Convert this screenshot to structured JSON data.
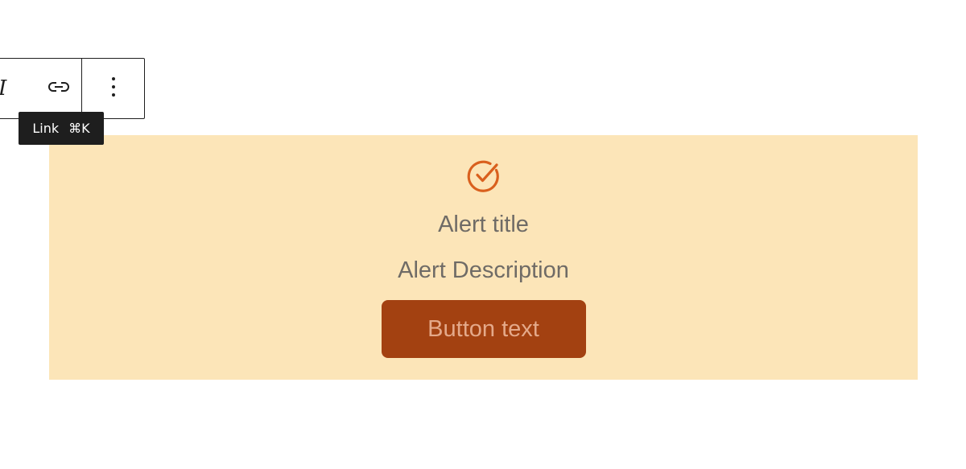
{
  "toolbar": {
    "italic_glyph": "I",
    "items": [
      {
        "name": "italic",
        "icon": "italic-icon"
      },
      {
        "name": "link",
        "icon": "link-icon"
      },
      {
        "name": "more-options",
        "icon": "more-vertical-icon"
      }
    ]
  },
  "tooltip": {
    "label": "Link",
    "shortcut": "⌘K"
  },
  "alert": {
    "icon": "check-circle-icon",
    "title": "Alert title",
    "description": "Alert Description",
    "button_label": "Button text",
    "colors": {
      "background": "#fce5b8",
      "icon": "#d9601e",
      "text": "#6f6b66",
      "button": "#a34111",
      "button_text": "#e4a98a"
    }
  }
}
